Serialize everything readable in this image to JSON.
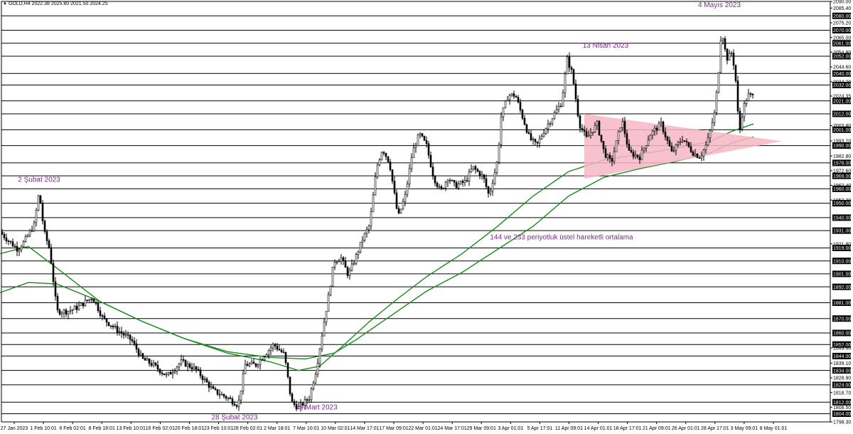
{
  "header": {
    "symbol_line": "GOLD,H4  2022.38 2025.80 2021.50 2024.25"
  },
  "colors": {
    "candle": "#000000",
    "ema": "#1b8a1b",
    "triangle_fill": "#f7b6c6",
    "annotation": "#7a2a8a",
    "hline": "#000000"
  },
  "chart_data": {
    "type": "candlestick",
    "title": "",
    "xlabel": "",
    "ylabel": "",
    "ylim": [
      1798.3,
      2090.0
    ],
    "grid": false,
    "y_tick_labels": [
      "2090.00",
      "2085.40",
      "2080.00",
      "2075.20",
      "2070.00",
      "2065.00",
      "2061.00",
      "2054.80",
      "2052.00",
      "2044.60",
      "2040.00",
      "2034.20",
      "2032.00",
      "2024.35",
      "2021.00",
      "2012.00",
      "2003.80",
      "2001.00",
      "1993.20",
      "1990.00",
      "1982.80",
      "1978.00",
      "1972.60",
      "1969.00",
      "1962.40",
      "1960.00",
      "1952.20",
      "1950.00",
      "1940.00",
      "1931.00",
      "1921.80",
      "1919.00",
      "1910.00",
      "1901.00",
      "1892.00",
      "1881.00",
      "1870.00",
      "1860.00",
      "1852.00",
      "1849.60",
      "1844.00",
      "1839.10",
      "1834.00",
      "1828.90",
      "1824.00",
      "1818.70",
      "1812.00",
      "1808.50",
      "1804.00",
      "1798.30"
    ],
    "y_highlight_labels": [
      "2080.00",
      "2070.00",
      "2061.00",
      "2052.00",
      "2040.00",
      "2032.00",
      "2021.00",
      "2012.00",
      "2001.00",
      "1990.00",
      "1978.00",
      "1969.00",
      "1960.00",
      "1950.00",
      "1940.00",
      "1931.00",
      "1919.00",
      "1910.00",
      "1901.00",
      "1892.00",
      "1881.00",
      "1870.00",
      "1860.00",
      "1852.00",
      "1844.00",
      "1834.00",
      "1824.00",
      "1812.00",
      "1804.00"
    ],
    "horizontal_levels": [
      2080,
      2070,
      2061,
      2052,
      2040,
      2032,
      2021,
      2012,
      2001,
      1990,
      1978,
      1969,
      1960,
      1950,
      1940,
      1931,
      1919,
      1910,
      1901,
      1892,
      1881,
      1870,
      1860,
      1852,
      1844,
      1834,
      1824,
      1812,
      1804
    ],
    "x_tick_labels": [
      "27 Jan 2023",
      "1 Feb 10:01",
      "6 Feb 02:01",
      "8 Feb 18:01",
      "13 Feb 10:01",
      "16 Feb 02:01",
      "20 Feb 18:01",
      "23 Feb 10:01",
      "28 Feb 02:01",
      "2 Mar 18:01",
      "7 Mar 10:01",
      "10 Mar 02:01",
      "14 Mar 17:01",
      "17 Mar 09:01",
      "22 Mar 01:01",
      "24 Mar 17:01",
      "29 Mar 09:01",
      "3 Apr 01:01",
      "5 Apr 17:01",
      "11 Apr 09:01",
      "14 Apr 01:01",
      "18 Apr 17:01",
      "21 Apr 09:01",
      "26 Apr 01:01",
      "28 Apr 17:01",
      "3 May 09:01",
      "8 May 01:01"
    ],
    "price_path": [
      [
        0,
        1930
      ],
      [
        10,
        1925
      ],
      [
        25,
        1918
      ],
      [
        35,
        1924
      ],
      [
        48,
        1935
      ],
      [
        55,
        1958
      ],
      [
        62,
        1930
      ],
      [
        70,
        1918
      ],
      [
        80,
        1875
      ],
      [
        95,
        1875
      ],
      [
        110,
        1878
      ],
      [
        130,
        1885
      ],
      [
        145,
        1870
      ],
      [
        165,
        1862
      ],
      [
        185,
        1855
      ],
      [
        200,
        1842
      ],
      [
        215,
        1838
      ],
      [
        235,
        1830
      ],
      [
        255,
        1840
      ],
      [
        275,
        1835
      ],
      [
        300,
        1820
      ],
      [
        320,
        1815
      ],
      [
        335,
        1810
      ],
      [
        345,
        1838
      ],
      [
        360,
        1838
      ],
      [
        385,
        1852
      ],
      [
        400,
        1845
      ],
      [
        410,
        1812
      ],
      [
        420,
        1808
      ],
      [
        435,
        1815
      ],
      [
        445,
        1835
      ],
      [
        455,
        1865
      ],
      [
        462,
        1885
      ],
      [
        470,
        1910
      ],
      [
        480,
        1912
      ],
      [
        490,
        1900
      ],
      [
        500,
        1912
      ],
      [
        510,
        1925
      ],
      [
        520,
        1935
      ],
      [
        530,
        1975
      ],
      [
        538,
        1988
      ],
      [
        548,
        1978
      ],
      [
        560,
        1940
      ],
      [
        570,
        1955
      ],
      [
        580,
        1985
      ],
      [
        590,
        1998
      ],
      [
        600,
        1990
      ],
      [
        610,
        1968
      ],
      [
        620,
        1958
      ],
      [
        630,
        1968
      ],
      [
        640,
        1962
      ],
      [
        655,
        1965
      ],
      [
        665,
        1975
      ],
      [
        680,
        1968
      ],
      [
        688,
        1955
      ],
      [
        700,
        1980
      ],
      [
        705,
        2010
      ],
      [
        715,
        2025
      ],
      [
        725,
        2025
      ],
      [
        735,
        2010
      ],
      [
        745,
        1995
      ],
      [
        755,
        1990
      ],
      [
        765,
        2000
      ],
      [
        775,
        2008
      ],
      [
        790,
        2020
      ],
      [
        798,
        2050
      ],
      [
        805,
        2040
      ],
      [
        815,
        2005
      ],
      [
        825,
        1995
      ],
      [
        840,
        2005
      ],
      [
        850,
        1985
      ],
      [
        860,
        1978
      ],
      [
        875,
        2008
      ],
      [
        885,
        1985
      ],
      [
        900,
        1982
      ],
      [
        915,
        1998
      ],
      [
        930,
        2005
      ],
      [
        945,
        1985
      ],
      [
        960,
        1995
      ],
      [
        975,
        1985
      ],
      [
        985,
        1982
      ],
      [
        995,
        1992
      ],
      [
        1005,
        2012
      ],
      [
        1010,
        2035
      ],
      [
        1015,
        2072
      ],
      [
        1022,
        2050
      ],
      [
        1030,
        2055
      ],
      [
        1035,
        2035
      ],
      [
        1040,
        1998
      ],
      [
        1045,
        2015
      ],
      [
        1052,
        2025
      ],
      [
        1060,
        2024
      ]
    ],
    "series": [
      {
        "values": [
          [
            0,
            1915
          ],
          [
            40,
            1920
          ],
          [
            80,
            1905
          ],
          [
            140,
            1882
          ],
          [
            200,
            1868
          ],
          [
            260,
            1856
          ],
          [
            320,
            1846
          ],
          [
            380,
            1840
          ],
          [
            420,
            1834
          ],
          [
            450,
            1837
          ],
          [
            480,
            1850
          ],
          [
            520,
            1868
          ],
          [
            560,
            1884
          ],
          [
            600,
            1899
          ],
          [
            650,
            1915
          ],
          [
            700,
            1934
          ],
          [
            750,
            1955
          ],
          [
            800,
            1972
          ],
          [
            850,
            1980
          ],
          [
            900,
            1984
          ],
          [
            950,
            1988
          ],
          [
            1000,
            1993
          ],
          [
            1030,
            2000
          ],
          [
            1060,
            2005
          ]
        ]
      },
      {
        "values": [
          [
            0,
            1888
          ],
          [
            40,
            1895
          ],
          [
            80,
            1894
          ],
          [
            140,
            1882
          ],
          [
            200,
            1868
          ],
          [
            260,
            1856
          ],
          [
            320,
            1847
          ],
          [
            380,
            1843
          ],
          [
            430,
            1842
          ],
          [
            470,
            1846
          ],
          [
            500,
            1855
          ],
          [
            550,
            1872
          ],
          [
            600,
            1889
          ],
          [
            650,
            1902
          ],
          [
            700,
            1918
          ],
          [
            750,
            1934
          ],
          [
            800,
            1955
          ],
          [
            850,
            1968
          ],
          [
            900,
            1974
          ],
          [
            950,
            1979
          ],
          [
            1000,
            1985
          ],
          [
            1030,
            1992
          ],
          [
            1060,
            1996
          ]
        ]
      }
    ],
    "triangle": {
      "vertices": [
        [
          822,
          2012
        ],
        [
          1100,
          1993
        ],
        [
          822,
          1967
        ]
      ]
    },
    "annotations": [
      {
        "text": "2 Şubat 2023",
        "x": 55,
        "y": 1965
      },
      {
        "text": "28 Şubat 2023",
        "x": 330,
        "y": 1800
      },
      {
        "text": "9 Mart 2023",
        "x": 448,
        "y": 1807
      },
      {
        "text": "13 Nisan 2023",
        "x": 852,
        "y": 2058
      },
      {
        "text": "4 Mayıs 2023",
        "x": 1012,
        "y": 2086
      },
      {
        "text": "144 ve 233 periyotluk üstel hareketli ortalama",
        "x": 790,
        "y": 1925
      }
    ]
  }
}
